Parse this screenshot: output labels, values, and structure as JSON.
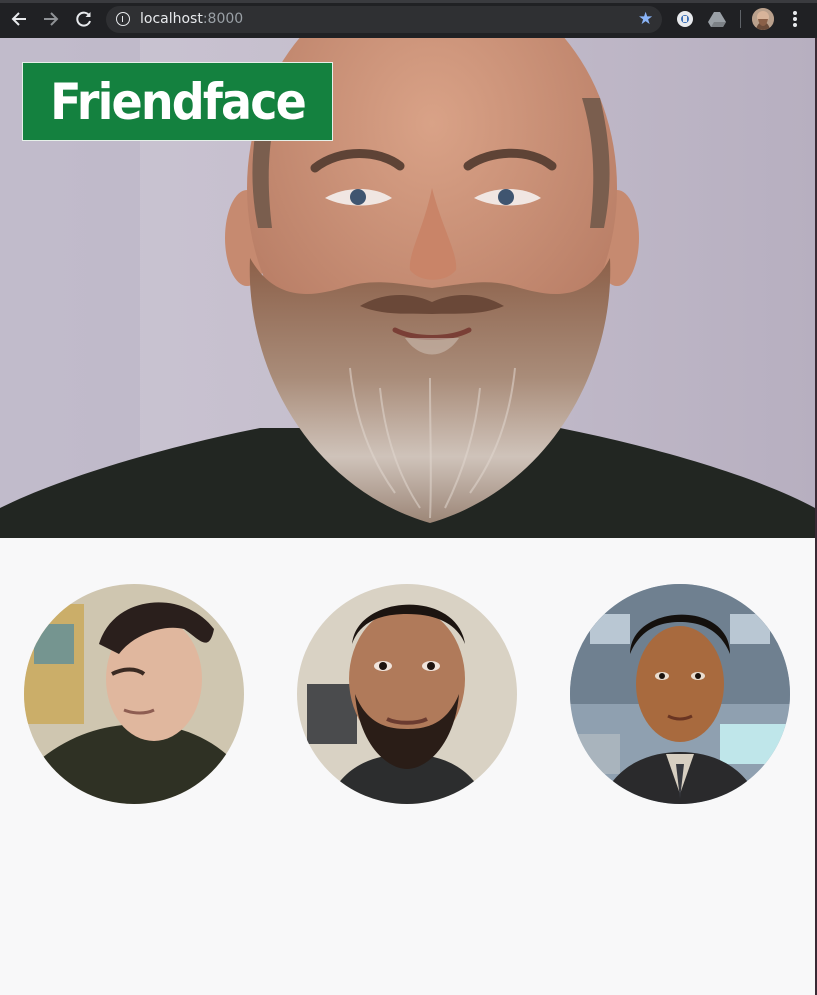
{
  "browser": {
    "url_host": "localhost",
    "url_port": ":8000",
    "colors": {
      "chrome": "#202124",
      "omnibox": "#2f3033",
      "star": "#8ab4f8"
    },
    "icons": [
      "back-arrow-icon",
      "forward-arrow-icon",
      "reload-icon",
      "info-icon",
      "bookmark-star-icon",
      "extension-icon",
      "drive-icon",
      "menu-dots-icon"
    ]
  },
  "page": {
    "brand_name": "Friendface",
    "brand_color": "#14813f",
    "background": "#f8f8f9",
    "friends": [
      {
        "alt": "friend-1"
      },
      {
        "alt": "friend-2"
      },
      {
        "alt": "friend-3"
      }
    ]
  }
}
